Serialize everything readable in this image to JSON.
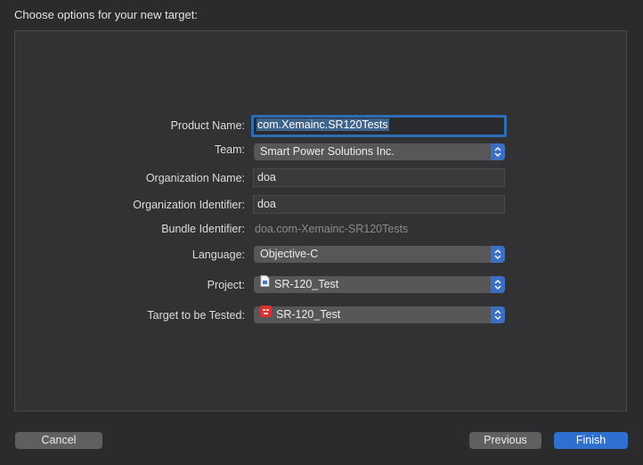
{
  "heading": "Choose options for your new target:",
  "form": {
    "product_name_label": "Product Name:",
    "product_name_value": "com.Xemainc.SR120Tests",
    "team_label": "Team:",
    "team_value": "Smart Power Solutions Inc.",
    "org_name_label": "Organization Name:",
    "org_name_value": "doa",
    "org_id_label": "Organization Identifier:",
    "org_id_value": "doa",
    "bundle_id_label": "Bundle Identifier:",
    "bundle_id_value": "doa.com-Xemainc-SR120Tests",
    "language_label": "Language:",
    "language_value": "Objective-C",
    "project_label": "Project:",
    "project_value": "SR-120_Test",
    "project_icon": "project-file-icon",
    "target_label": "Target to be Tested:",
    "target_value": "SR-120_Test",
    "target_icon": "app-target-icon"
  },
  "buttons": {
    "cancel": "Cancel",
    "previous": "Previous",
    "finish": "Finish"
  },
  "colors": {
    "accent": "#2f6fd0",
    "focus_ring": "#2d6db6",
    "target_icon": "#d6322e"
  }
}
